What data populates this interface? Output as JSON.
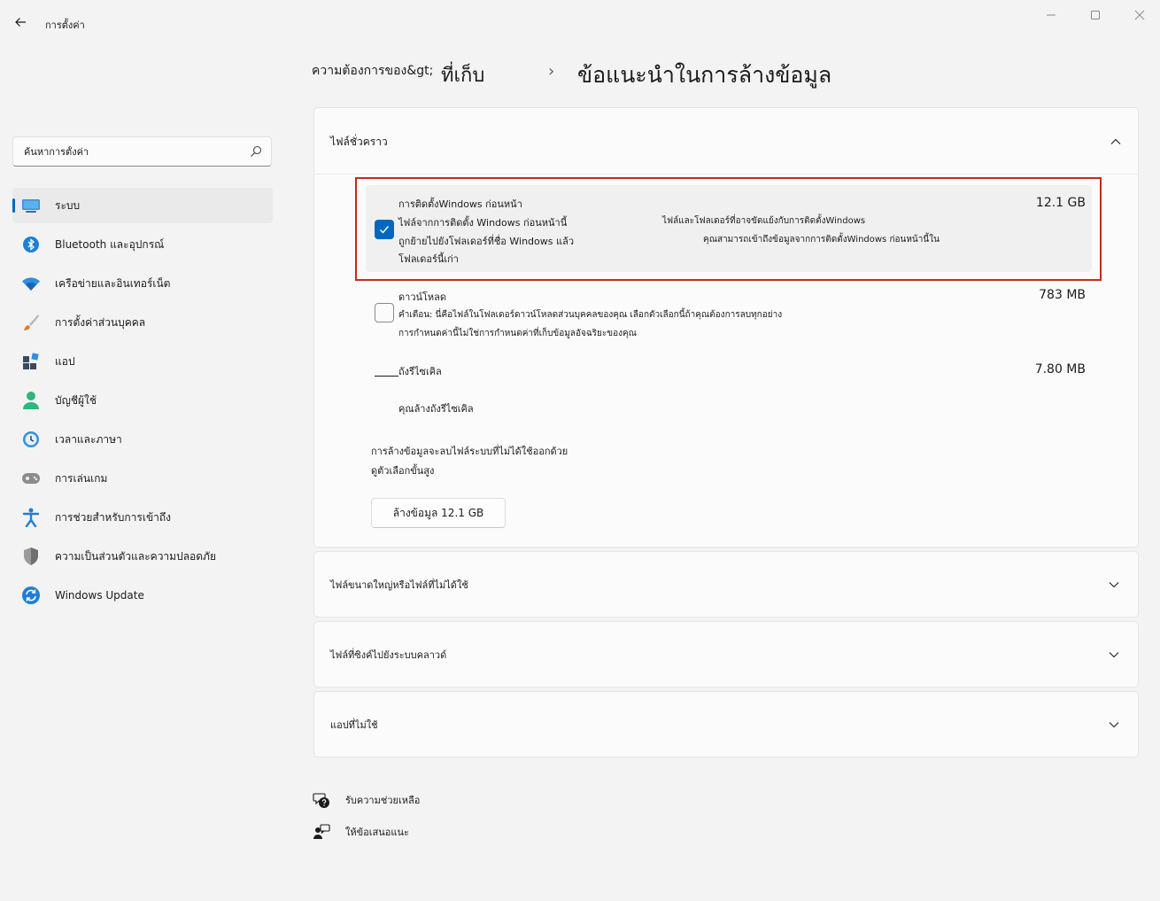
{
  "window": {
    "title": "การตั้งค่า"
  },
  "search": {
    "placeholder": "ค้นหาการตั้งค่า"
  },
  "nav": {
    "items": [
      {
        "label": "ระบบ"
      },
      {
        "label": "Bluetooth และอุปกรณ์"
      },
      {
        "label": "เครือข่ายและอินเทอร์เน็ต"
      },
      {
        "label": "การตั้งค่าส่วนบุคคล"
      },
      {
        "label": "แอป"
      },
      {
        "label": "บัญชีผู้ใช้"
      },
      {
        "label": "เวลาและภาษา"
      },
      {
        "label": "การเล่นเกม"
      },
      {
        "label": "การช่วยสำหรับการเข้าถึง"
      },
      {
        "label": "ความเป็นส่วนตัวและความปลอดภัย"
      },
      {
        "label": "Windows Update"
      }
    ]
  },
  "breadcrumb": {
    "part1": "ความต้องการของ&gt;",
    "part2": "ที่เก็บ",
    "separator": "›",
    "current": "ข้อแนะนำในการล้างข้อมูล"
  },
  "temp": {
    "title": "ไฟล์ชั่วคราว",
    "prev_install": {
      "title": "การติดตั้งWindows ก่อนหน้า",
      "line1": "ไฟล์จากการติดตั้ง Windows ก่อนหน้านี้",
      "line2": "ถูกย้ายไปยังโฟลเดอร์ที่ชื่อ Windows แล้ว",
      "line3": "โฟลเดอร์นี้เก่า",
      "note1": "ไฟล์และโฟลเดอร์ที่อาจขัดแย้งกับการติดตั้งWindows",
      "note2": "คุณสามารถเข้าถึงข้อมูลจากการติดตั้งWindows ก่อนหน้านี้ใน",
      "size": "12.1 GB",
      "checked": true
    },
    "downloads": {
      "title": "ดาวน์โหลด",
      "line1": "คำเตือน: นี่คือไฟล์ในโฟลเดอร์ดาวน์โหลดส่วนบุคคลของคุณ เลือกตัวเลือกนี้ถ้าคุณต้องการลบทุกอย่าง",
      "line2": "การกำหนดค่านี้ไม่ใช่การกำหนดค่าที่เก็บข้อมูลอัจฉริยะของคุณ",
      "size": "783 MB",
      "checked": false
    },
    "recycle": {
      "title": "ถังรีไซเคิล",
      "line1": "คุณล้างถังรีไซเคิล",
      "size": "7.80 MB"
    },
    "footer_line1": "การล้างข้อมูลจะลบไฟล์ระบบที่ไม่ได้ใช้ออกด้วย",
    "footer_line2": "ดูตัวเลือกขั้นสูง",
    "clean_button": "ล้างข้อมูล 12.1 GB"
  },
  "sections": {
    "large": "ไฟล์ขนาดใหญ่หรือไฟล์ที่ไม่ได้ใช้",
    "cloud": "ไฟล์ที่ซิงค์ไปยังระบบคลาวด์",
    "unused_apps": "แอปที่ไม่ใช้"
  },
  "links": {
    "help": "รับความช่วยเหลือ",
    "feedback": "ให้ข้อเสนอแนะ"
  },
  "colors": {
    "accent": "#0067c0",
    "highlight_frame": "#c42b1c"
  }
}
